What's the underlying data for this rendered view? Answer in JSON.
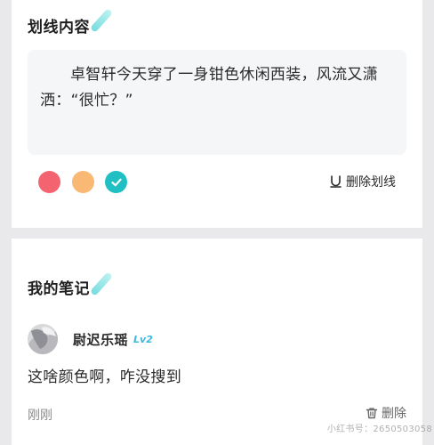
{
  "highlight": {
    "title": "划线内容",
    "quote": "卓智轩今天穿了一身钳色休闲西装，风流又潇洒：“很忙？”",
    "colors": [
      {
        "name": "red",
        "hex": "#f46470"
      },
      {
        "name": "orange",
        "hex": "#f9b873"
      },
      {
        "name": "teal",
        "hex": "#1fbfc4",
        "selected": true
      }
    ],
    "delete_label": "删除划线"
  },
  "note": {
    "title": "我的笔记",
    "username": "尉迟乐瑶",
    "level": "Lv2",
    "content": "这啥颜色啊，咋没搜到",
    "time": "刚刚",
    "delete_label": "删除"
  },
  "watermark": "小红书号：2650503058"
}
